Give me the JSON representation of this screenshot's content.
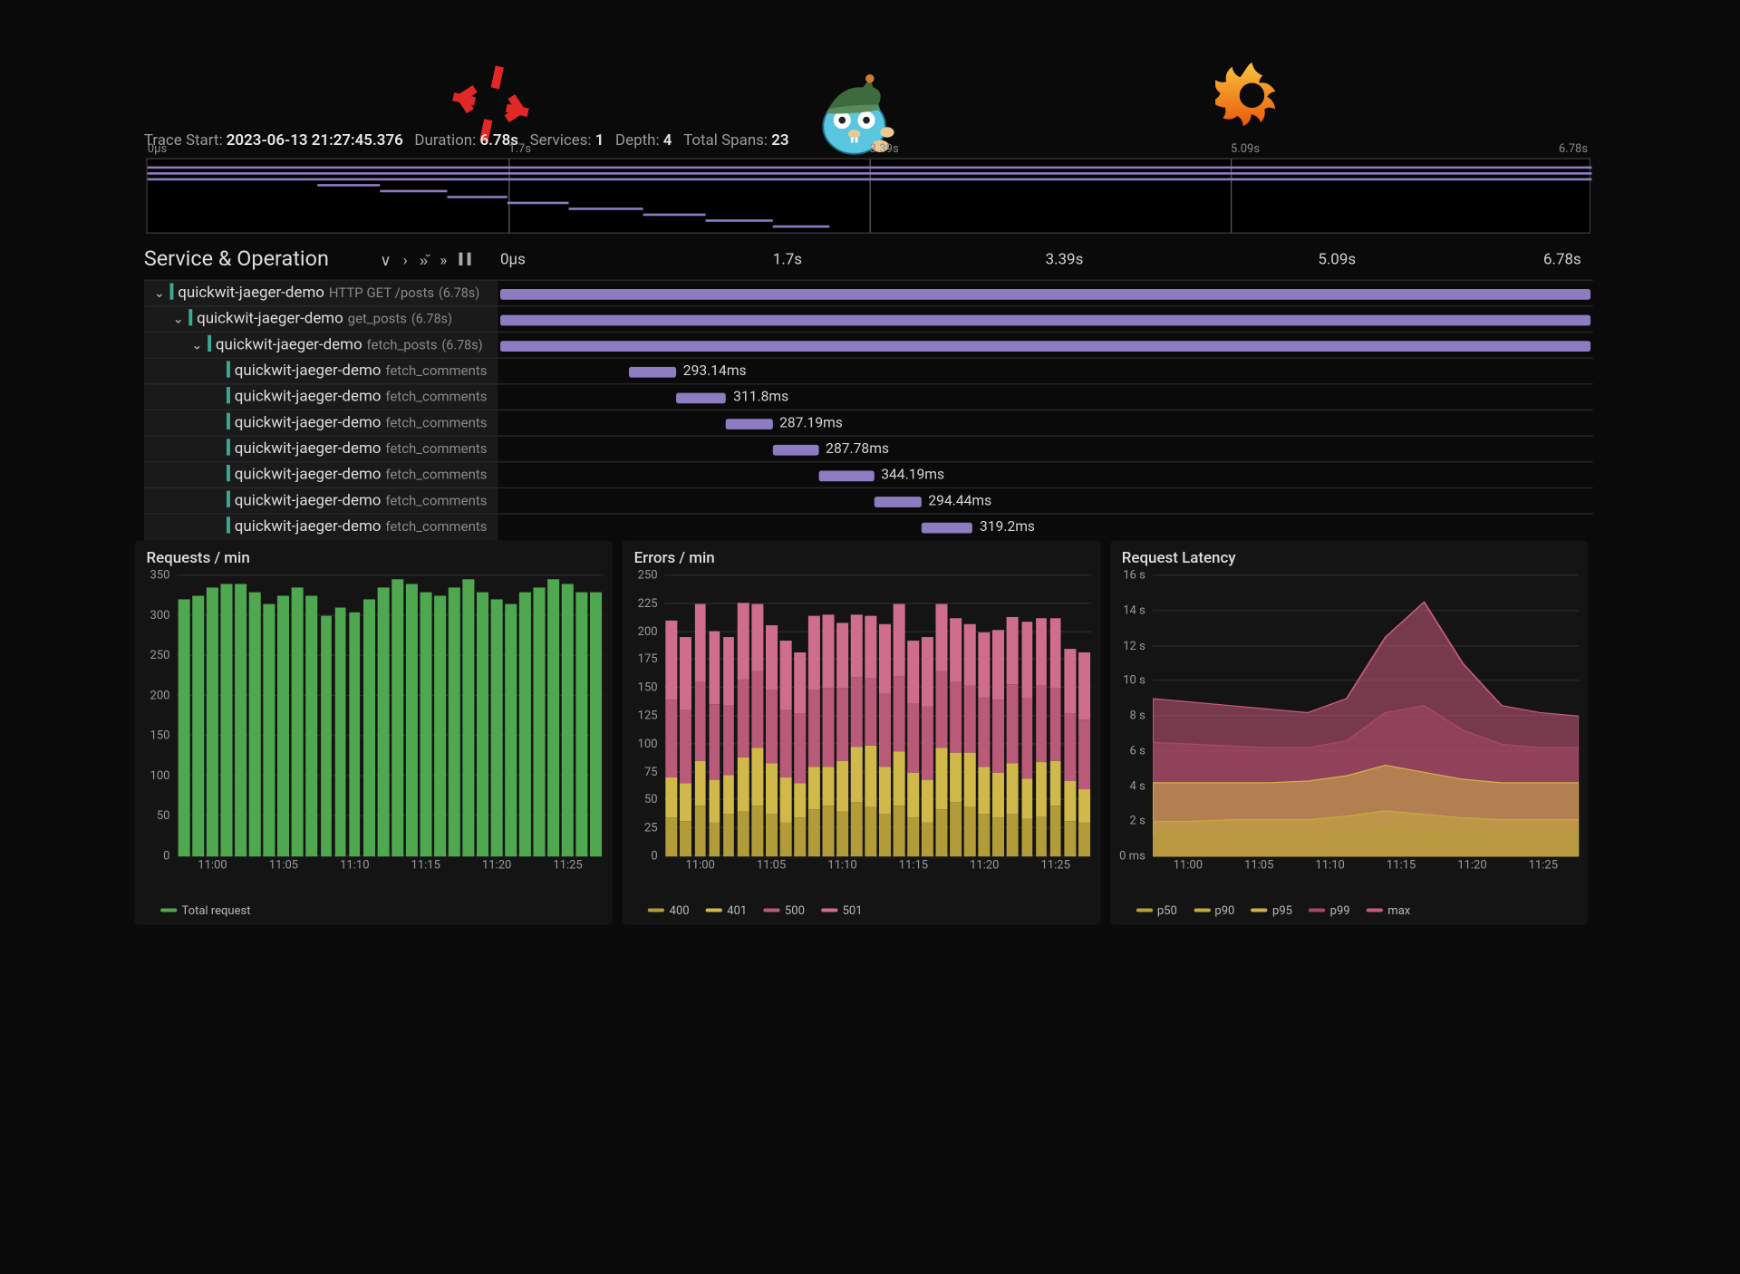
{
  "trace_header": {
    "labels": {
      "start": "Trace Start:",
      "duration": "Duration:",
      "services": "Services:",
      "depth": "Depth:",
      "spans": "Total Spans:"
    },
    "start": "2023-06-13 21:27:45.376",
    "duration": "6.78s",
    "services": "1",
    "depth": "4",
    "spans": "23"
  },
  "timeline_ticks": [
    "0µs",
    "1.7s",
    "3.39s",
    "5.09s",
    "6.78s"
  ],
  "span_tree": {
    "header": "Service & Operation",
    "service": "quickwit-jaeger-demo",
    "rows": [
      {
        "depth": 0,
        "caret": true,
        "op": "HTTP GET /posts",
        "dur": "(6.78s)",
        "start_ms": 0,
        "len_ms": 6780,
        "label": ""
      },
      {
        "depth": 1,
        "caret": true,
        "op": "get_posts",
        "dur": "(6.78s)",
        "start_ms": 0,
        "len_ms": 6780,
        "label": ""
      },
      {
        "depth": 2,
        "caret": true,
        "op": "fetch_posts",
        "dur": "(6.78s)",
        "start_ms": 0,
        "len_ms": 6780,
        "label": ""
      },
      {
        "depth": 3,
        "caret": false,
        "op": "fetch_comments",
        "dur": "",
        "start_ms": 800,
        "len_ms": 293,
        "label": "293.14ms"
      },
      {
        "depth": 3,
        "caret": false,
        "op": "fetch_comments",
        "dur": "",
        "start_ms": 1093,
        "len_ms": 312,
        "label": "311.8ms"
      },
      {
        "depth": 3,
        "caret": false,
        "op": "fetch_comments",
        "dur": "",
        "start_ms": 1405,
        "len_ms": 287,
        "label": "287.19ms"
      },
      {
        "depth": 3,
        "caret": false,
        "op": "fetch_comments",
        "dur": "",
        "start_ms": 1692,
        "len_ms": 288,
        "label": "287.78ms"
      },
      {
        "depth": 3,
        "caret": false,
        "op": "fetch_comments",
        "dur": "",
        "start_ms": 1980,
        "len_ms": 344,
        "label": "344.19ms"
      },
      {
        "depth": 3,
        "caret": false,
        "op": "fetch_comments",
        "dur": "",
        "start_ms": 2324,
        "len_ms": 294,
        "label": "294.44ms"
      },
      {
        "depth": 3,
        "caret": false,
        "op": "fetch_comments",
        "dur": "",
        "start_ms": 2618,
        "len_ms": 319,
        "label": "319.2ms"
      }
    ],
    "bar_color": "#8e7cc3",
    "accent_color": "#3fa796"
  },
  "chart_data": [
    {
      "type": "bar",
      "title": "Requests / min",
      "yticks": [
        0,
        50,
        100,
        150,
        200,
        250,
        300,
        350
      ],
      "ylim": [
        0,
        350
      ],
      "xticks": [
        "11:00",
        "11:05",
        "11:10",
        "11:15",
        "11:20",
        "11:25"
      ],
      "categories": [
        "11:00",
        "11:01",
        "11:02",
        "11:03",
        "11:04",
        "11:05",
        "11:06",
        "11:07",
        "11:08",
        "11:09",
        "11:10",
        "11:11",
        "11:12",
        "11:13",
        "11:14",
        "11:15",
        "11:16",
        "11:17",
        "11:18",
        "11:19",
        "11:20",
        "11:21",
        "11:22",
        "11:23",
        "11:24",
        "11:25",
        "11:26",
        "11:27",
        "11:28",
        "11:29"
      ],
      "values": [
        320,
        325,
        335,
        340,
        340,
        330,
        315,
        325,
        335,
        325,
        300,
        310,
        305,
        320,
        335,
        345,
        340,
        330,
        325,
        335,
        345,
        330,
        320,
        315,
        330,
        335,
        345,
        340,
        330,
        330
      ],
      "legend": [
        "Total request"
      ],
      "color": "#4fa84f"
    },
    {
      "type": "bar_stacked",
      "title": "Errors / min",
      "yticks": [
        0,
        25,
        50,
        75,
        100,
        125,
        150,
        175,
        200,
        225,
        250
      ],
      "ylim": [
        0,
        250
      ],
      "xticks": [
        "11:00",
        "11:05",
        "11:10",
        "11:15",
        "11:20",
        "11:25"
      ],
      "categories": [
        "11:00",
        "11:01",
        "11:02",
        "11:03",
        "11:04",
        "11:05",
        "11:06",
        "11:07",
        "11:08",
        "11:09",
        "11:10",
        "11:11",
        "11:12",
        "11:13",
        "11:14",
        "11:15",
        "11:16",
        "11:17",
        "11:18",
        "11:19",
        "11:20",
        "11:21",
        "11:22",
        "11:23",
        "11:24",
        "11:25",
        "11:26",
        "11:27",
        "11:28",
        "11:29"
      ],
      "series": [
        {
          "name": "400",
          "color": "#b29c3a",
          "values": [
            35,
            32,
            45,
            30,
            38,
            40,
            45,
            38,
            30,
            35,
            42,
            45,
            40,
            48,
            44,
            38,
            45,
            35,
            30,
            42,
            48,
            44,
            38,
            35,
            38,
            34,
            36,
            45,
            32,
            30
          ]
        },
        {
          "name": "401",
          "color": "#d0b84a",
          "values": [
            35,
            33,
            40,
            38,
            35,
            48,
            52,
            45,
            40,
            30,
            38,
            35,
            45,
            50,
            55,
            42,
            48,
            40,
            38,
            55,
            44,
            48,
            42,
            40,
            45,
            35,
            48,
            40,
            35,
            30
          ]
        },
        {
          "name": "500",
          "color": "#b85a78",
          "values": [
            70,
            65,
            70,
            68,
            62,
            70,
            68,
            65,
            60,
            62,
            68,
            70,
            65,
            62,
            60,
            65,
            68,
            62,
            65,
            68,
            64,
            60,
            62,
            65,
            70,
            72,
            68,
            65,
            60,
            62
          ]
        },
        {
          "name": "501",
          "color": "#cf6e8c",
          "values": [
            70,
            65,
            70,
            65,
            60,
            68,
            60,
            58,
            62,
            55,
            66,
            65,
            58,
            55,
            55,
            62,
            64,
            55,
            62,
            60,
            56,
            55,
            58,
            62,
            60,
            68,
            60,
            62,
            58,
            60
          ]
        }
      ],
      "legend": [
        "400",
        "401",
        "500",
        "501"
      ]
    },
    {
      "type": "area",
      "title": "Request Latency",
      "yticks_labels": [
        "0 ms",
        "2 s",
        "4 s",
        "6 s",
        "8 s",
        "10 s",
        "12 s",
        "14 s",
        "16 s"
      ],
      "yticks": [
        0,
        2,
        4,
        6,
        8,
        10,
        12,
        14,
        16
      ],
      "ylim": [
        0,
        16
      ],
      "xticks": [
        "11:00",
        "11:05",
        "11:10",
        "11:15",
        "11:20",
        "11:25"
      ],
      "x": [
        0,
        1,
        2,
        3,
        4,
        5,
        6,
        7,
        8,
        9,
        10,
        11
      ],
      "series": [
        {
          "name": "p50",
          "color": "#b79f3a",
          "values": [
            1.2,
            1.2,
            1.2,
            1.2,
            1.2,
            1.3,
            1.5,
            1.4,
            1.3,
            1.2,
            1.2,
            1.2
          ]
        },
        {
          "name": "p90",
          "color": "#c4aa3f",
          "values": [
            2.0,
            2.0,
            2.1,
            2.1,
            2.1,
            2.3,
            2.6,
            2.4,
            2.2,
            2.1,
            2.1,
            2.1
          ]
        },
        {
          "name": "p95",
          "color": "#cfb347",
          "values": [
            4.2,
            4.2,
            4.2,
            4.2,
            4.3,
            4.6,
            5.2,
            4.8,
            4.4,
            4.2,
            4.2,
            4.2
          ]
        },
        {
          "name": "p99",
          "color": "#a84868",
          "values": [
            6.5,
            6.4,
            6.3,
            6.2,
            6.2,
            6.6,
            8.2,
            8.6,
            7.2,
            6.4,
            6.2,
            6.2
          ]
        },
        {
          "name": "max",
          "color": "#c85a7c",
          "values": [
            9.0,
            8.8,
            8.6,
            8.4,
            8.2,
            9.0,
            12.5,
            14.5,
            11.0,
            8.6,
            8.2,
            8.0
          ]
        }
      ],
      "legend": [
        "p50",
        "p90",
        "p95",
        "p99",
        "max"
      ]
    }
  ]
}
